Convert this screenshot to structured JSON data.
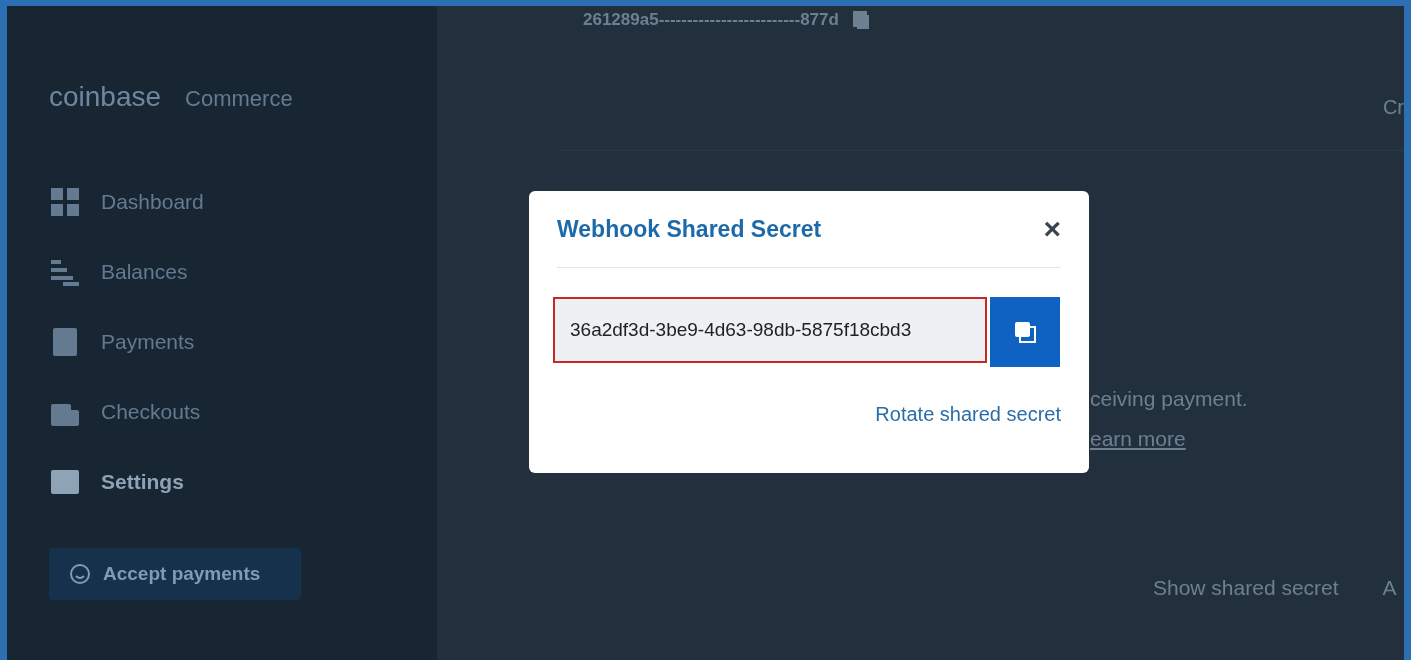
{
  "sidebar": {
    "logo": "coinbase",
    "product": "Commerce",
    "items": [
      {
        "label": "Dashboard",
        "kind": "grid",
        "selected": false
      },
      {
        "label": "Balances",
        "kind": "coins",
        "selected": false
      },
      {
        "label": "Payments",
        "kind": "list",
        "selected": false
      },
      {
        "label": "Checkouts",
        "kind": "bag",
        "selected": false
      },
      {
        "label": "Settings",
        "kind": "window",
        "selected": true
      }
    ],
    "button": "Accept payments"
  },
  "page": {
    "api_key": "261289a5-------------------------877d",
    "column_1": "Cr",
    "description": "ceiving payment.",
    "link": "earn more",
    "show_secret": "Show shared secret",
    "column_2": "A"
  },
  "modal": {
    "title": "Webhook Shared Secret",
    "close": "×",
    "secret": "36a2df3d-3be9-4d63-98db-5875f18cbd3",
    "rotate": "Rotate shared secret"
  }
}
